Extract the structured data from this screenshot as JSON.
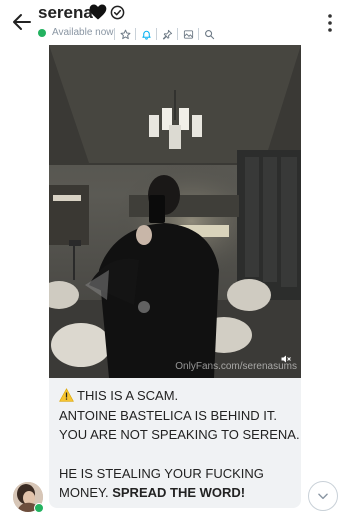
{
  "header": {
    "name": "serena",
    "status": "Available now",
    "colors": {
      "online": "#23b260",
      "accent": "#00aff0"
    },
    "icons": [
      "back-arrow-icon",
      "black-heart-icon",
      "verified-icon",
      "star-icon",
      "bell-icon",
      "pin-icon",
      "gallery-icon",
      "search-icon",
      "more-vertical-icon"
    ]
  },
  "post": {
    "watermark": "OnlyFans.com/serenasums",
    "message": {
      "line1": "THIS IS A SCAM.",
      "line2": "ANTOINE BASTELICA IS BEHIND IT.",
      "line3": "YOU ARE NOT SPEAKING TO SERENA.",
      "line4a": "HE IS STEALING YOUR FUCKING",
      "line5a": "MONEY. ",
      "line5b": "SPREAD THE WORD!"
    }
  },
  "footer": {
    "icons": [
      "avatar",
      "chevron-down-icon"
    ]
  }
}
